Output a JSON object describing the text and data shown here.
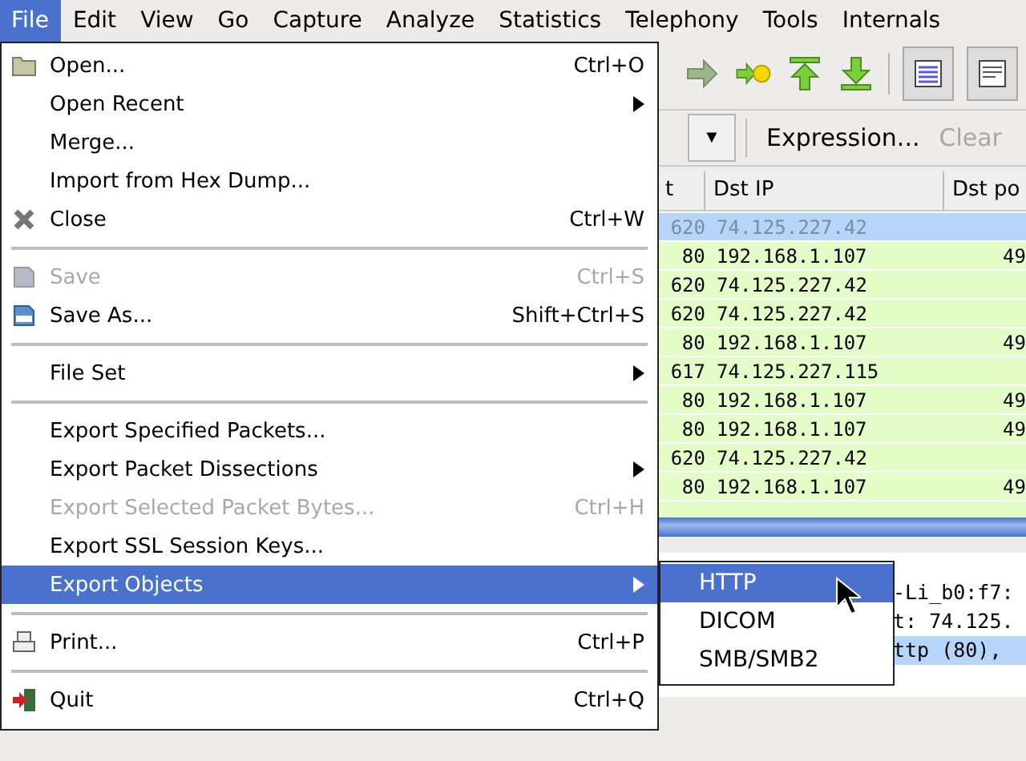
{
  "menubar": [
    {
      "label": "File",
      "selected": true
    },
    {
      "label": "Edit",
      "selected": false
    },
    {
      "label": "View",
      "selected": false
    },
    {
      "label": "Go",
      "selected": false
    },
    {
      "label": "Capture",
      "selected": false
    },
    {
      "label": "Analyze",
      "selected": false
    },
    {
      "label": "Statistics",
      "selected": false
    },
    {
      "label": "Telephony",
      "selected": false
    },
    {
      "label": "Tools",
      "selected": false
    },
    {
      "label": "Internals",
      "selected": false
    }
  ],
  "file_menu": [
    {
      "kind": "item",
      "label": "Open...",
      "shortcut": "Ctrl+O",
      "disabled": false,
      "selected": false
    },
    {
      "kind": "submenu",
      "label": "Open Recent",
      "disabled": false,
      "selected": false
    },
    {
      "kind": "item",
      "label": "Merge...",
      "disabled": false,
      "selected": false
    },
    {
      "kind": "item",
      "label": "Import from Hex Dump...",
      "disabled": false,
      "selected": false
    },
    {
      "kind": "item",
      "label": "Close",
      "shortcut": "Ctrl+W",
      "disabled": false,
      "selected": false
    },
    {
      "kind": "separator"
    },
    {
      "kind": "item",
      "label": "Save",
      "shortcut": "Ctrl+S",
      "disabled": true,
      "selected": false
    },
    {
      "kind": "item",
      "label": "Save As...",
      "shortcut": "Shift+Ctrl+S",
      "disabled": false,
      "selected": false
    },
    {
      "kind": "separator"
    },
    {
      "kind": "submenu",
      "label": "File Set",
      "disabled": false,
      "selected": false
    },
    {
      "kind": "separator"
    },
    {
      "kind": "item",
      "label": "Export Specified Packets...",
      "disabled": false,
      "selected": false
    },
    {
      "kind": "submenu",
      "label": "Export Packet Dissections",
      "disabled": false,
      "selected": false
    },
    {
      "kind": "item",
      "label": "Export Selected Packet Bytes...",
      "shortcut": "Ctrl+H",
      "disabled": true,
      "selected": false
    },
    {
      "kind": "item",
      "label": "Export SSL Session Keys...",
      "disabled": false,
      "selected": false
    },
    {
      "kind": "submenu",
      "label": "Export Objects",
      "disabled": false,
      "selected": true
    },
    {
      "kind": "separator"
    },
    {
      "kind": "item",
      "label": "Print...",
      "shortcut": "Ctrl+P",
      "disabled": false,
      "selected": false
    },
    {
      "kind": "separator"
    },
    {
      "kind": "item",
      "label": "Quit",
      "shortcut": "Ctrl+Q",
      "disabled": false,
      "selected": false
    }
  ],
  "export_objects_submenu": [
    {
      "label": "HTTP",
      "selected": true
    },
    {
      "label": "DICOM",
      "selected": false
    },
    {
      "label": "SMB/SMB2",
      "selected": false
    }
  ],
  "filter_bar": {
    "dropdown": "▼",
    "expression": "Expression...",
    "clear": "Clear"
  },
  "packet_list": {
    "columns": [
      "t",
      "Dst IP",
      "Dst po"
    ],
    "rows": [
      {
        "cells": [
          "620",
          "74.125.227.42",
          ""
        ],
        "selected": true
      },
      {
        "cells": [
          "80",
          "192.168.1.107",
          "49"
        ],
        "selected": false
      },
      {
        "cells": [
          "620",
          "74.125.227.42",
          ""
        ],
        "selected": false
      },
      {
        "cells": [
          "620",
          "74.125.227.42",
          ""
        ],
        "selected": false
      },
      {
        "cells": [
          "80",
          "192.168.1.107",
          "49"
        ],
        "selected": false
      },
      {
        "cells": [
          "617",
          "74.125.227.115",
          ""
        ],
        "selected": false
      },
      {
        "cells": [
          "80",
          "192.168.1.107",
          "49"
        ],
        "selected": false
      },
      {
        "cells": [
          "80",
          "192.168.1.107",
          "49"
        ],
        "selected": false
      },
      {
        "cells": [
          "620",
          "74.125.227.42",
          ""
        ],
        "selected": false
      },
      {
        "cells": [
          "80",
          "192.168.1.107",
          "49"
        ],
        "selected": false
      }
    ]
  },
  "details": [
    {
      "text": "-Li_b0:f7:",
      "selected": false
    },
    {
      "text": "t: 74.125.",
      "selected": false
    },
    {
      "text": "ttp (80),",
      "selected": true
    }
  ]
}
